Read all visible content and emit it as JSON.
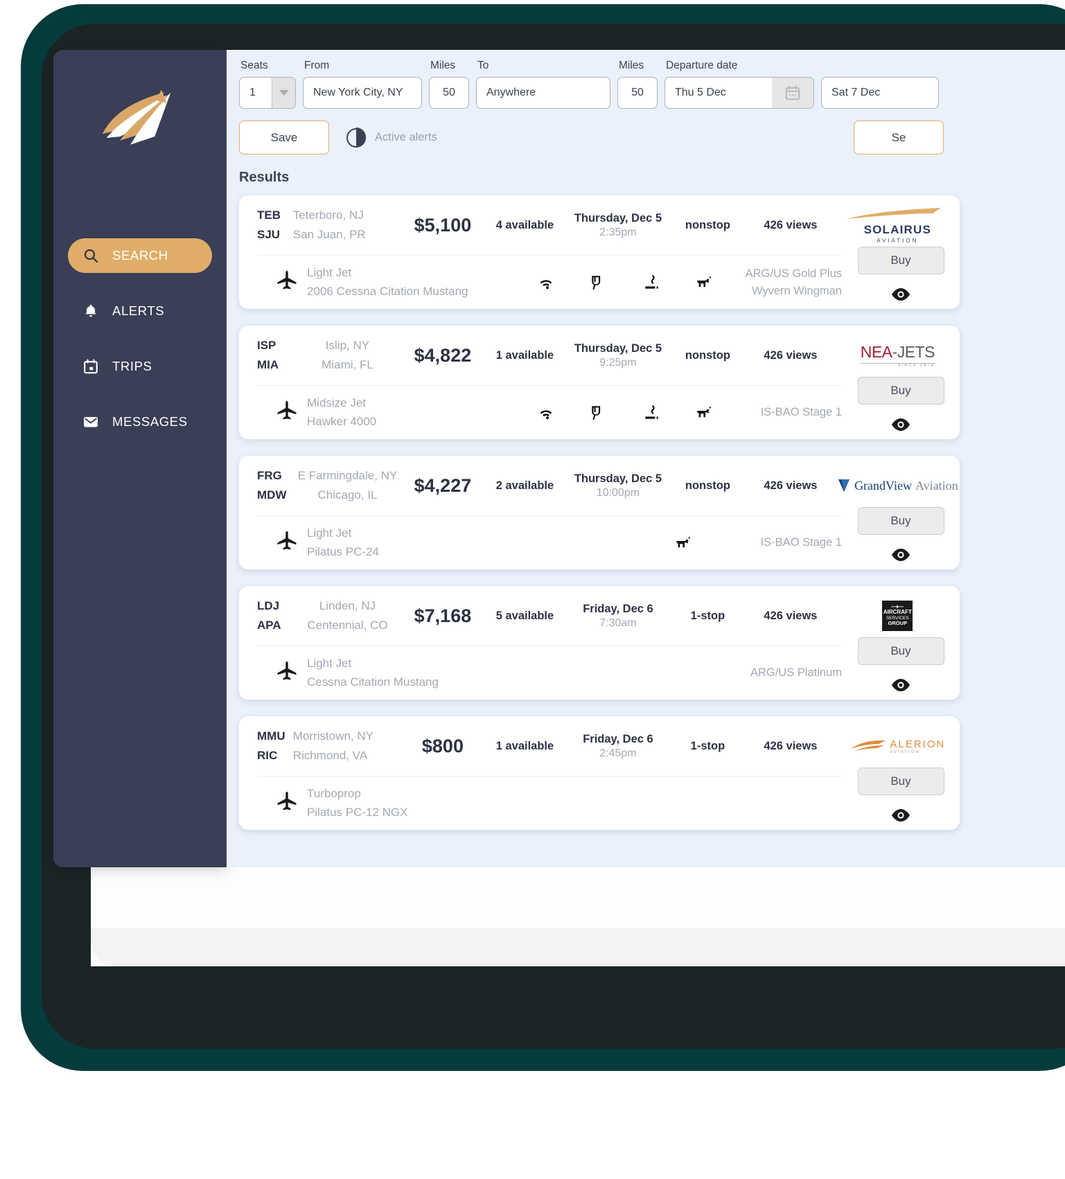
{
  "sidebar": {
    "logo_name": "paper-plane-logo",
    "items": [
      {
        "label": "SEARCH",
        "icon": "search-icon",
        "active": true
      },
      {
        "label": "ALERTS",
        "icon": "bell-icon",
        "active": false
      },
      {
        "label": "TRIPS",
        "icon": "calendar-icon",
        "active": false
      },
      {
        "label": "MESSAGES",
        "icon": "envelope-icon",
        "active": false
      }
    ]
  },
  "search": {
    "seats_label": "Seats",
    "seats_value": "1",
    "from_label": "From",
    "from_value": "New York City, NY",
    "from_miles_label": "Miles",
    "from_miles_value": "50",
    "to_label": "To",
    "to_value": "Anywhere",
    "to_miles_label": "Miles",
    "to_miles_value": "50",
    "departure_label": "Departure date",
    "departure_value": "Thu 5 Dec",
    "return_value": "Sat 7 Dec",
    "save_label": "Save",
    "alerts_label": "Active alerts",
    "search_label": "Se"
  },
  "results": {
    "title": "Results",
    "buy_label": "Buy",
    "cards": [
      {
        "origin_code": "TEB",
        "origin_city": "Teterboro, NJ",
        "dest_code": "SJU",
        "dest_city": "San Juan, PR",
        "price": "$5,100",
        "availability": "4 available",
        "date": "Thursday, Dec 5",
        "time": "2:35pm",
        "stops": "nonstop",
        "views": "426 views",
        "operator": "SOLAIRUS AVIATION",
        "operator_logo": "solairus",
        "aircraft_class": "Light Jet",
        "aircraft_model": "2006 Cessna Citation Mustang",
        "amenities": [
          "wifi-icon",
          "lavatory-icon",
          "smoking-icon",
          "pet-icon"
        ],
        "safety": [
          "ARG/US Gold Plus",
          "Wyvern Wingman"
        ]
      },
      {
        "origin_code": "ISP",
        "origin_city": "Islip, NY",
        "dest_code": "MIA",
        "dest_city": "Miami, FL",
        "price": "$4,822",
        "availability": "1 available",
        "date": "Thursday, Dec 5",
        "time": "9:25pm",
        "stops": "nonstop",
        "views": "426 views",
        "operator": "NEA-JETS",
        "operator_logo": "nea",
        "aircraft_class": "Midsize Jet",
        "aircraft_model": "Hawker 4000",
        "amenities": [
          "wifi-icon",
          "lavatory-icon",
          "smoking-icon",
          "pet-icon"
        ],
        "safety": [
          "IS-BAO Stage 1"
        ]
      },
      {
        "origin_code": "FRG",
        "origin_city": "E Farmingdale, NY",
        "dest_code": "MDW",
        "dest_city": "Chicago, IL",
        "price": "$4,227",
        "availability": "2 available",
        "date": "Thursday, Dec 5",
        "time": "10:00pm",
        "stops": "nonstop",
        "views": "426 views",
        "operator": "GrandViewAviation",
        "operator_logo": "grandview",
        "aircraft_class": "Light Jet",
        "aircraft_model": "Pilatus PC-24",
        "amenities": [
          "pet-icon"
        ],
        "safety": [
          "IS-BAO Stage 1"
        ]
      },
      {
        "origin_code": "LDJ",
        "origin_city": "Linden, NJ",
        "dest_code": "APA",
        "dest_city": "Centennial, CO",
        "price": "$7,168",
        "availability": "5 available",
        "date": "Friday, Dec 6",
        "time": "7:30am",
        "stops": "1-stop",
        "views": "426 views",
        "operator": "AIRCRAFT SERVICES GROUP",
        "operator_logo": "asg",
        "aircraft_class": "Light Jet",
        "aircraft_model": "Cessna Citation Mustang",
        "amenities": [],
        "safety": [
          "ARG/US Platinum"
        ]
      },
      {
        "origin_code": "MMU",
        "origin_city": "Morristown, NY",
        "dest_code": "RIC",
        "dest_city": "Richmond, VA",
        "price": "$800",
        "availability": "1 available",
        "date": "Friday, Dec 6",
        "time": "2:45pm",
        "stops": "1-stop",
        "views": "426 views",
        "operator": "ALERION AVIATION",
        "operator_logo": "alerion",
        "aircraft_class": "Turboprop",
        "aircraft_model": "Pilatus PC-12 NGX",
        "amenities": [],
        "safety": []
      }
    ]
  },
  "colors": {
    "sidebar_bg": "#3a3e56",
    "accent": "#e0ad68",
    "main_bg": "#eaf1fb",
    "card_bg": "#ffffff",
    "text_dark": "#2d3142",
    "text_muted": "#a3a8b4",
    "frame_teal": "#063b3b"
  }
}
